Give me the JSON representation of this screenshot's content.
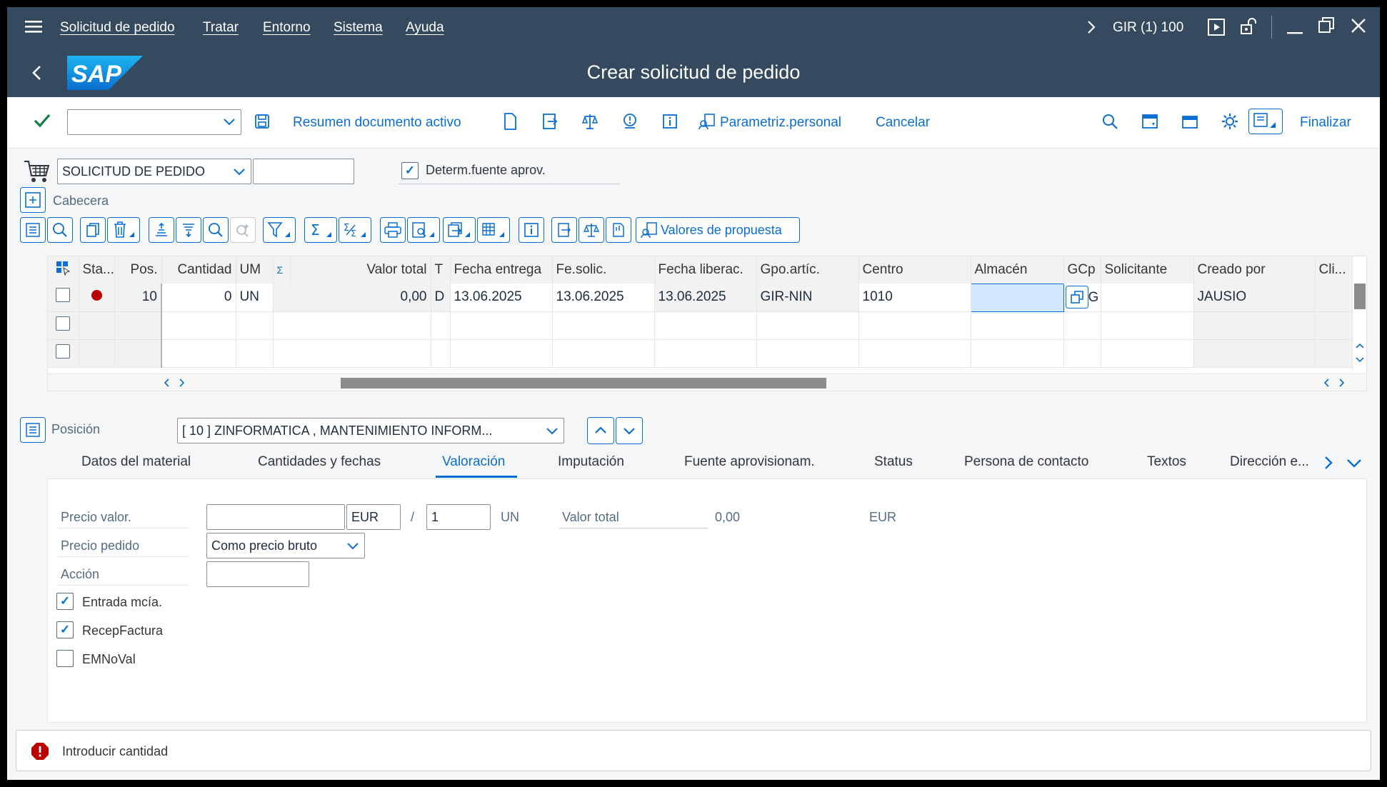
{
  "menubar": {
    "items": [
      "Solicitud de pedido",
      "Tratar",
      "Entorno",
      "Sistema",
      "Ayuda"
    ],
    "system": "GIR (1) 100"
  },
  "header": {
    "logo": "SAP",
    "title": "Crear solicitud de pedido"
  },
  "toolbar": {
    "resumen": "Resumen documento activo",
    "parametriz": "Parametriz.personal",
    "cancelar": "Cancelar",
    "finalizar": "Finalizar",
    "dropdown_value": ""
  },
  "doc": {
    "type": "SOLICITUD DE PEDIDO",
    "number": "",
    "determ_label": "Determ.fuente aprov.",
    "determ_checked": true,
    "cabecera": "Cabecera",
    "valores": "Valores de propuesta"
  },
  "table": {
    "columns": [
      "Sta...",
      "Pos.",
      "Cantidad",
      "UM",
      "Σ",
      "Valor total",
      "T",
      "Fecha entrega",
      "Fe.solic.",
      "Fecha liberac.",
      "Gpo.artíc.",
      "Centro",
      "Almacén",
      "GCp",
      "Solicitante",
      "Creado por",
      "Cli..."
    ],
    "rows": [
      {
        "pos": "10",
        "cantidad": "0",
        "um": "UN",
        "valor": "0,00",
        "t": "D",
        "fecha_entrega": "13.06.2025",
        "fe_solic": "13.06.2025",
        "fecha_lib": "13.06.2025",
        "gpo": "GIR-NIN",
        "centro": "1010",
        "almacen": "",
        "gcp": "G",
        "solicitante": "",
        "creado": "JAUSIO",
        "cli": ""
      }
    ]
  },
  "posicion": {
    "label": "Posición",
    "value": "[ 10 ] ZINFORMATICA , MANTENIMIENTO INFORM..."
  },
  "tabs": [
    "Datos del material",
    "Cantidades y fechas",
    "Valoración",
    "Imputación",
    "Fuente aprovisionam.",
    "Status",
    "Persona de contacto",
    "Textos",
    "Dirección e..."
  ],
  "active_tab": "Valoración",
  "valoracion": {
    "precio_valor_label": "Precio valor.",
    "precio_valor": "",
    "currency": "EUR",
    "slash": "/",
    "per": "1",
    "unit": "UN",
    "valor_total_label": "Valor total",
    "valor_total": "0,00",
    "valor_total_currency": "EUR",
    "precio_pedido_label": "Precio pedido",
    "precio_pedido": "Como precio bruto",
    "accion_label": "Acción",
    "accion": "",
    "entrada_label": "Entrada mcía.",
    "recep_label": "RecepFactura",
    "emnoval_label": "EMNoVal"
  },
  "status": {
    "message": "Introducir cantidad"
  },
  "colors": {
    "shell": "#354a5f",
    "accent": "#0a6ed1",
    "error": "#bb0000"
  }
}
